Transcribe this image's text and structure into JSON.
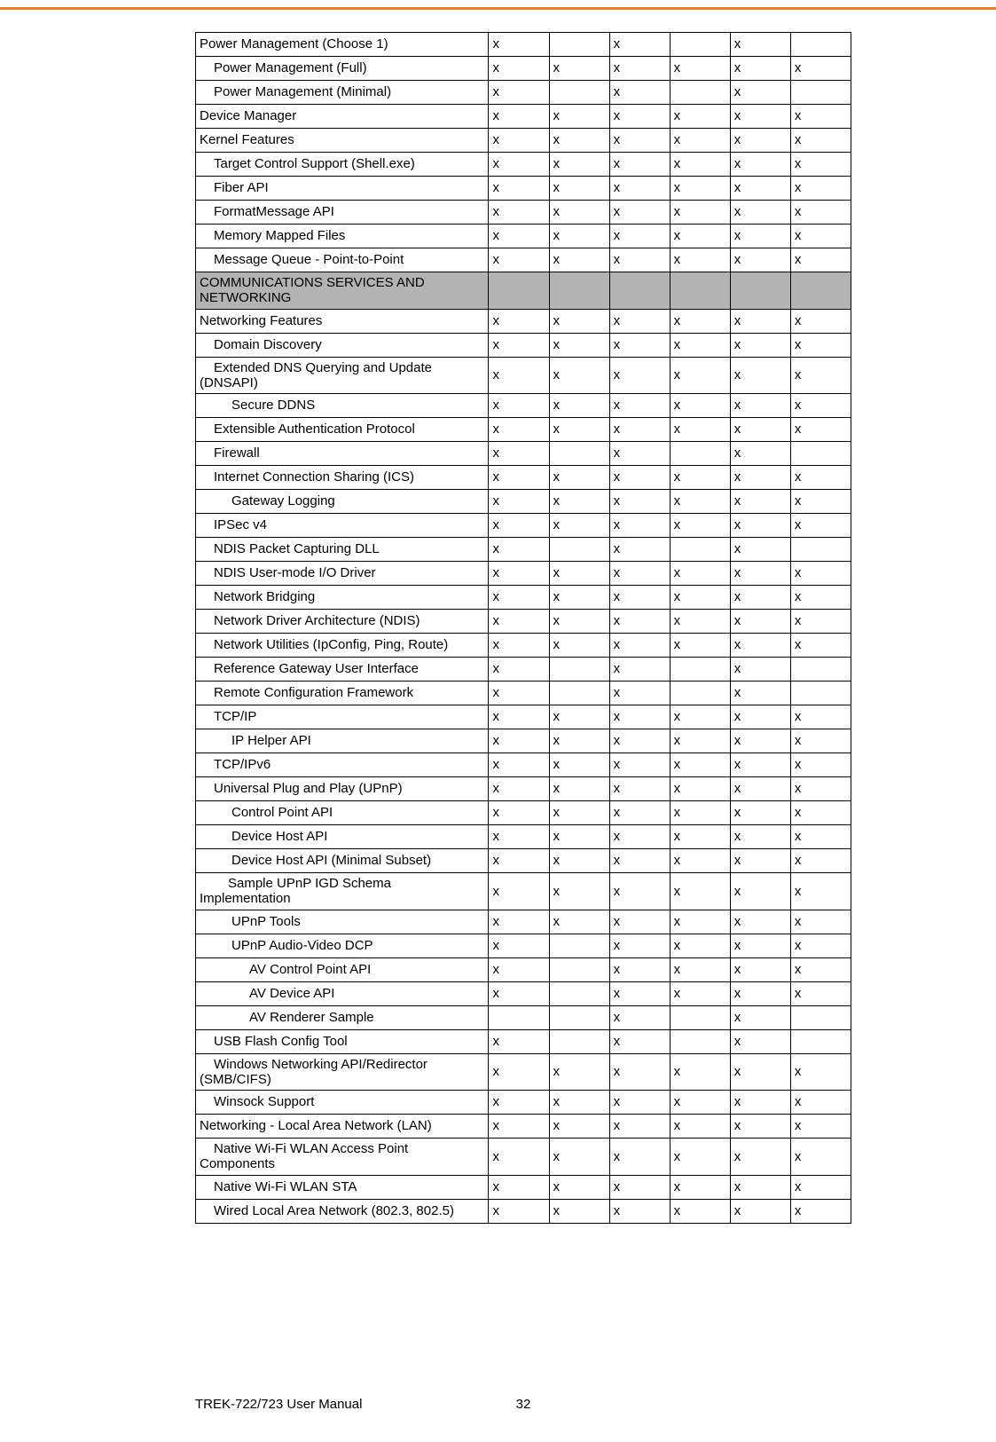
{
  "colors": {
    "accent": "#f47a20",
    "section_bg": "#b3b3b3"
  },
  "footer": {
    "manual": "TREK-722/723 User Manual",
    "page": "32"
  },
  "mark": "x",
  "rows": [
    {
      "label": "Power Management (Choose 1)",
      "indent": 0,
      "cols": [
        "x",
        "",
        "x",
        "",
        "x",
        ""
      ]
    },
    {
      "label": "Power Management (Full)",
      "indent": 1,
      "cols": [
        "x",
        "x",
        "x",
        "x",
        "x",
        "x"
      ]
    },
    {
      "label": "Power Management (Minimal)",
      "indent": 1,
      "cols": [
        "x",
        "",
        "x",
        "",
        "x",
        ""
      ]
    },
    {
      "label": "Device Manager",
      "indent": 0,
      "cols": [
        "x",
        "x",
        "x",
        "x",
        "x",
        "x"
      ]
    },
    {
      "label": "Kernel Features",
      "indent": 0,
      "cols": [
        "x",
        "x",
        "x",
        "x",
        "x",
        "x"
      ]
    },
    {
      "label": "Target Control Support (Shell.exe)",
      "indent": 1,
      "cols": [
        "x",
        "x",
        "x",
        "x",
        "x",
        "x"
      ]
    },
    {
      "label": "Fiber API",
      "indent": 1,
      "cols": [
        "x",
        "x",
        "x",
        "x",
        "x",
        "x"
      ]
    },
    {
      "label": "FormatMessage API",
      "indent": 1,
      "cols": [
        "x",
        "x",
        "x",
        "x",
        "x",
        "x"
      ]
    },
    {
      "label": "Memory Mapped Files",
      "indent": 1,
      "cols": [
        "x",
        "x",
        "x",
        "x",
        "x",
        "x"
      ]
    },
    {
      "label": "Message Queue - Point-to-Point",
      "indent": 1,
      "cols": [
        "x",
        "x",
        "x",
        "x",
        "x",
        "x"
      ]
    },
    {
      "section": true,
      "label": "COMMUNICATIONS SERVICES AND NETWORKING"
    },
    {
      "label": "Networking Features",
      "indent": 0,
      "cols": [
        "x",
        "x",
        "x",
        "x",
        "x",
        "x"
      ]
    },
    {
      "label": "Domain Discovery",
      "indent": 1,
      "cols": [
        "x",
        "x",
        "x",
        "x",
        "x",
        "x"
      ]
    },
    {
      "label": "Extended DNS Querying and Update (DNSAPI)",
      "indent": 1,
      "wrap": true,
      "cols": [
        "x",
        "x",
        "x",
        "x",
        "x",
        "x"
      ]
    },
    {
      "label": "Secure DDNS",
      "indent": 2,
      "cols": [
        "x",
        "x",
        "x",
        "x",
        "x",
        "x"
      ]
    },
    {
      "label": "Extensible Authentication Protocol",
      "indent": 1,
      "cols": [
        "x",
        "x",
        "x",
        "x",
        "x",
        "x"
      ]
    },
    {
      "label": "Firewall",
      "indent": 1,
      "cols": [
        "x",
        "",
        "x",
        "",
        "x",
        ""
      ]
    },
    {
      "label": "Internet Connection Sharing (ICS)",
      "indent": 1,
      "cols": [
        "x",
        "x",
        "x",
        "x",
        "x",
        "x"
      ]
    },
    {
      "label": "Gateway Logging",
      "indent": 2,
      "cols": [
        "x",
        "x",
        "x",
        "x",
        "x",
        "x"
      ]
    },
    {
      "label": "IPSec v4",
      "indent": 1,
      "cols": [
        "x",
        "x",
        "x",
        "x",
        "x",
        "x"
      ]
    },
    {
      "label": "NDIS Packet Capturing DLL",
      "indent": 1,
      "cols": [
        "x",
        "",
        "x",
        "",
        "x",
        ""
      ]
    },
    {
      "label": "NDIS User-mode I/O Driver",
      "indent": 1,
      "cols": [
        "x",
        "x",
        "x",
        "x",
        "x",
        "x"
      ]
    },
    {
      "label": "Network Bridging",
      "indent": 1,
      "cols": [
        "x",
        "x",
        "x",
        "x",
        "x",
        "x"
      ]
    },
    {
      "label": "Network Driver Architecture (NDIS)",
      "indent": 1,
      "cols": [
        "x",
        "x",
        "x",
        "x",
        "x",
        "x"
      ]
    },
    {
      "label": "Network Utilities (IpConfig, Ping, Route)",
      "indent": 1,
      "cols": [
        "x",
        "x",
        "x",
        "x",
        "x",
        "x"
      ]
    },
    {
      "label": "Reference Gateway User Interface",
      "indent": 1,
      "cols": [
        "x",
        "",
        "x",
        "",
        "x",
        ""
      ]
    },
    {
      "label": "Remote Configuration Framework",
      "indent": 1,
      "cols": [
        "x",
        "",
        "x",
        "",
        "x",
        ""
      ]
    },
    {
      "label": "TCP/IP",
      "indent": 1,
      "cols": [
        "x",
        "x",
        "x",
        "x",
        "x",
        "x"
      ]
    },
    {
      "label": "IP Helper API",
      "indent": 2,
      "cols": [
        "x",
        "x",
        "x",
        "x",
        "x",
        "x"
      ]
    },
    {
      "label": "TCP/IPv6",
      "indent": 1,
      "cols": [
        "x",
        "x",
        "x",
        "x",
        "x",
        "x"
      ]
    },
    {
      "label": "Universal Plug and Play (UPnP)",
      "indent": 1,
      "cols": [
        "x",
        "x",
        "x",
        "x",
        "x",
        "x"
      ]
    },
    {
      "label": "Control Point API",
      "indent": 2,
      "cols": [
        "x",
        "x",
        "x",
        "x",
        "x",
        "x"
      ]
    },
    {
      "label": "Device Host API",
      "indent": 2,
      "cols": [
        "x",
        "x",
        "x",
        "x",
        "x",
        "x"
      ]
    },
    {
      "label": "Device Host API (Minimal Subset)",
      "indent": 2,
      "cols": [
        "x",
        "x",
        "x",
        "x",
        "x",
        "x"
      ]
    },
    {
      "label": "Sample UPnP IGD Schema Implementation",
      "indent": 2,
      "wrap": true,
      "cols": [
        "x",
        "x",
        "x",
        "x",
        "x",
        "x"
      ]
    },
    {
      "label": "UPnP Tools",
      "indent": 2,
      "cols": [
        "x",
        "x",
        "x",
        "x",
        "x",
        "x"
      ]
    },
    {
      "label": "UPnP Audio-Video DCP",
      "indent": 2,
      "cols": [
        "x",
        "",
        "x",
        "x",
        "x",
        "x"
      ]
    },
    {
      "label": "AV Control Point API",
      "indent": 3,
      "cols": [
        "x",
        "",
        "x",
        "x",
        "x",
        "x"
      ]
    },
    {
      "label": "AV Device API",
      "indent": 3,
      "cols": [
        "x",
        "",
        "x",
        "x",
        "x",
        "x"
      ]
    },
    {
      "label": "AV Renderer Sample",
      "indent": 3,
      "cols": [
        "",
        "",
        "x",
        "",
        "x",
        ""
      ]
    },
    {
      "label": "USB Flash Config Tool",
      "indent": 1,
      "cols": [
        "x",
        "",
        "x",
        "",
        "x",
        ""
      ]
    },
    {
      "label": "Windows Networking API/Redirector (SMB/CIFS)",
      "indent": 1,
      "wrap": true,
      "cols": [
        "x",
        "x",
        "x",
        "x",
        "x",
        "x"
      ]
    },
    {
      "label": "Winsock Support",
      "indent": 1,
      "cols": [
        "x",
        "x",
        "x",
        "x",
        "x",
        "x"
      ]
    },
    {
      "label": "Networking - Local Area Network (LAN)",
      "indent": 0,
      "cols": [
        "x",
        "x",
        "x",
        "x",
        "x",
        "x"
      ]
    },
    {
      "label": "Native Wi-Fi WLAN Access Point Components",
      "indent": 1,
      "wrap": true,
      "cols": [
        "x",
        "x",
        "x",
        "x",
        "x",
        "x"
      ]
    },
    {
      "label": "Native Wi-Fi WLAN STA",
      "indent": 1,
      "cols": [
        "x",
        "x",
        "x",
        "x",
        "x",
        "x"
      ]
    },
    {
      "label": "Wired Local Area Network (802.3, 802.5)",
      "indent": 1,
      "cols": [
        "x",
        "x",
        "x",
        "x",
        "x",
        "x"
      ]
    }
  ]
}
